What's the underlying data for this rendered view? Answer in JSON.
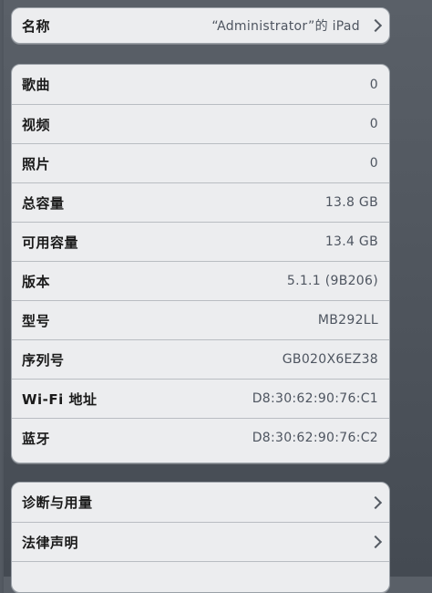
{
  "name_group": {
    "label": "名称",
    "value": "“Administrator”的 iPad",
    "chevron_icon": "chevron-right-icon"
  },
  "about_rows": [
    {
      "label": "歌曲",
      "value": "0"
    },
    {
      "label": "视频",
      "value": "0"
    },
    {
      "label": "照片",
      "value": "0"
    },
    {
      "label": "总容量",
      "value": "13.8 GB"
    },
    {
      "label": "可用容量",
      "value": "13.4 GB"
    },
    {
      "label": "版本",
      "value": "5.1.1 (9B206)"
    },
    {
      "label": "型号",
      "value": "MB292LL"
    },
    {
      "label": "序列号",
      "value": "GB020X6EZ38"
    },
    {
      "label": "Wi-Fi 地址",
      "value": "D8:30:62:90:76:C1"
    },
    {
      "label": "蓝牙",
      "value": "D8:30:62:90:76:C2"
    }
  ],
  "more_rows": [
    {
      "label": "诊断与用量",
      "chevron_icon": "chevron-right-icon"
    },
    {
      "label": "法律声明",
      "chevron_icon": "chevron-right-icon"
    }
  ]
}
